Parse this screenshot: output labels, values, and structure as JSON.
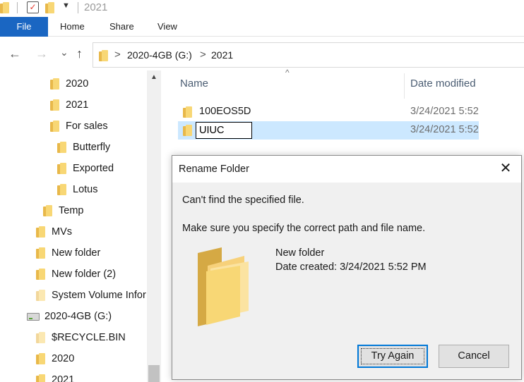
{
  "window": {
    "title": "2021",
    "properties_glyph": "✓",
    "qat_dropdown_glyph": "▼"
  },
  "ribbon": {
    "tabs": [
      "File",
      "Home",
      "Share",
      "View"
    ],
    "active_tab": "File",
    "accent": "#1a66c2"
  },
  "nav": {
    "back_glyph": "←",
    "forward_glyph": "→",
    "recent_glyph": "⌄",
    "up_glyph": "↑"
  },
  "address": {
    "breadcrumbs": [
      "2020-4GB (G:)",
      "2021"
    ],
    "separator": ">"
  },
  "tree": {
    "items": [
      {
        "label": "2020",
        "icon": "folder-icon"
      },
      {
        "label": "2021",
        "icon": "folder-icon"
      },
      {
        "label": "For sales",
        "icon": "folder-icon"
      },
      {
        "label": "Butterfly",
        "icon": "folder-icon"
      },
      {
        "label": "Exported",
        "icon": "folder-icon"
      },
      {
        "label": "Lotus",
        "icon": "folder-icon"
      },
      {
        "label": "Temp",
        "icon": "folder-icon"
      },
      {
        "label": "MVs",
        "icon": "folder-icon"
      },
      {
        "label": "New folder",
        "icon": "folder-icon"
      },
      {
        "label": "New folder (2)",
        "icon": "folder-icon"
      },
      {
        "label": "System Volume Infor",
        "icon": "folder-icon"
      },
      {
        "label": "2020-4GB (G:)",
        "icon": "usb-drive-icon"
      },
      {
        "label": "$RECYCLE.BIN",
        "icon": "folder-icon"
      },
      {
        "label": "2020",
        "icon": "folder-icon"
      },
      {
        "label": "2021",
        "icon": "folder-icon"
      }
    ]
  },
  "content": {
    "sort_glyph": "^",
    "columns": {
      "name": "Name",
      "date_modified": "Date modified"
    },
    "rows": [
      {
        "name": "100EOS5D",
        "date": "3/24/2021 5:52"
      },
      {
        "name": "UIUC",
        "date": "3/24/2021 5:52",
        "selected": true,
        "renaming": true
      }
    ],
    "selection_color": "#cce8ff"
  },
  "dialog": {
    "title": "Rename Folder",
    "close_glyph": "✕",
    "message1": "Can't find the specified file.",
    "message2": "Make sure you specify the correct path and file name.",
    "folder_name": "New folder",
    "date_created": "Date created: 3/24/2021 5:52 PM",
    "try_again_label": "Try Again",
    "cancel_label": "Cancel",
    "default_button_color": "#0078d7"
  }
}
